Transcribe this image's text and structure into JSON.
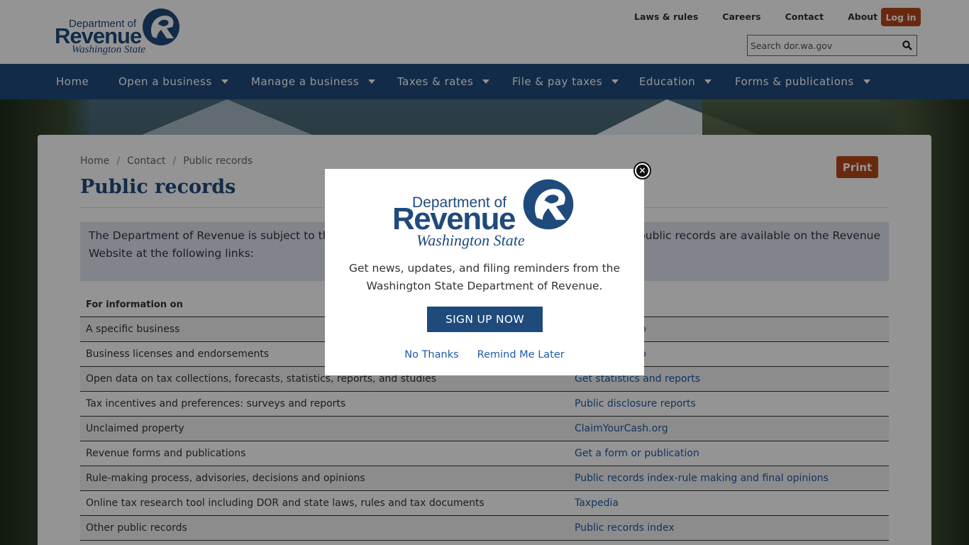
{
  "header": {
    "logo": {
      "line1": "Department of",
      "line2": "Revenue",
      "line3": "Washington State"
    },
    "utility_links": [
      "Laws & rules",
      "Careers",
      "Contact",
      "About"
    ],
    "login_label": "Log in",
    "search": {
      "placeholder": "Search dor.wa.gov",
      "icon": "search-icon"
    }
  },
  "nav": {
    "items": [
      {
        "label": "Home",
        "dropdown": false
      },
      {
        "label": "Open a business",
        "dropdown": true
      },
      {
        "label": "Manage a business",
        "dropdown": true
      },
      {
        "label": "Taxes & rates",
        "dropdown": true
      },
      {
        "label": "File & pay taxes",
        "dropdown": true
      },
      {
        "label": "Education",
        "dropdown": true
      },
      {
        "label": "Forms & publications",
        "dropdown": true
      }
    ]
  },
  "breadcrumb": [
    "Home",
    "Contact",
    "Public records"
  ],
  "print_label": "Print",
  "page_title": "Public records",
  "intro": {
    "left": "The Department of Revenue is subject to the",
    "right": "public records are available on the Revenue",
    "line2": "Website at the following links:"
  },
  "table": {
    "headers": [
      "For information on",
      ""
    ],
    "rows": [
      [
        "A specific business",
        "p"
      ],
      [
        "Business licenses and endorsements",
        "p"
      ],
      [
        "Open data on tax collections, forecasts, statistics, reports, and studies",
        "Get statistics and reports"
      ],
      [
        "Tax incentives and preferences: surveys and reports",
        "Public disclosure reports"
      ],
      [
        "Unclaimed property",
        "ClaimYourCash.org"
      ],
      [
        "Revenue forms and publications",
        "Get a form or publication"
      ],
      [
        "Rule-making process, advisories, decisions and opinions",
        "Public records index-rule making and final opinions"
      ],
      [
        "Online tax research tool including DOR and state laws, rules and tax documents",
        "Taxpedia"
      ],
      [
        "Other public records",
        "Public records index"
      ]
    ]
  },
  "modal": {
    "logo": {
      "line1": "Department of",
      "line2": "Revenue",
      "line3": "Washington State"
    },
    "message_line1": "Get news, updates, and filing reminders from the",
    "message_line2": "Washington State Department of Revenue.",
    "signup_label": "SIGN UP NOW",
    "no_thanks_label": "No Thanks",
    "remind_label": "Remind Me Later",
    "close_symbol": "×"
  },
  "colors": {
    "brand_blue": "#1f4a7c",
    "accent_orange": "#b5481b",
    "link_blue": "#1f5aa6",
    "intro_bg": "#dfe6f0"
  }
}
